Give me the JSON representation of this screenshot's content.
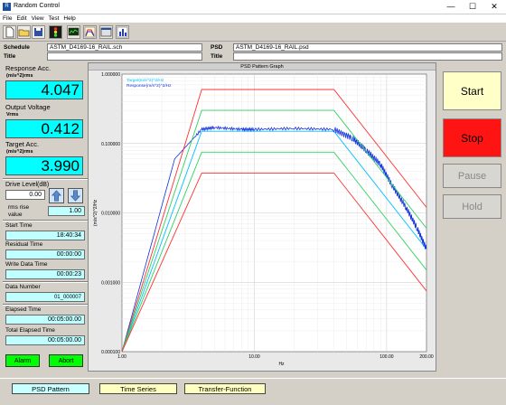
{
  "window": {
    "title": "Random Control",
    "minimize": "—",
    "maximize": "☐",
    "close": "✕"
  },
  "menu": [
    "File",
    "Edit",
    "View",
    "Test",
    "Help"
  ],
  "toolbar_icons": [
    "new-file-icon",
    "open-folder-icon",
    "save-icon",
    "traffic-light-icon",
    "monitor-icon",
    "psd-chart-icon",
    "window-icon",
    "bar-chart-icon"
  ],
  "header": {
    "schedule_label": "Schedule",
    "schedule_value": "ASTM_D4169-16_RAIL.sch",
    "title_label": "Title",
    "title_value": "",
    "psd_label": "PSD",
    "psd_value": "ASTM_D4169-16_RAIL.psd",
    "psd_title_label": "Title",
    "psd_title_value": ""
  },
  "left": {
    "response_label": "Response Acc.",
    "response_unit": "(m/s^2)rms",
    "response_value": "4.047",
    "output_label": "Output Voltage",
    "output_unit": "Vrms",
    "output_value": "0.412",
    "target_label": "Target Acc.",
    "target_unit": "(m/s^2)rms",
    "target_value": "3.990",
    "drive_label": "Drive Level(dB)",
    "drive_value": "0.00",
    "rms_rise_label_1": "rms rise",
    "rms_rise_label_2": "value",
    "rms_rise_value": "1.00",
    "start_time_label": "Start Time",
    "start_time_value": "18:40:34",
    "residual_label": "Residual Time",
    "residual_value": "00:00:00",
    "write_data_label": "Write Data Time",
    "write_data_value": "00:00:23",
    "data_number_label": "Data Number",
    "data_number_value": "01_000007",
    "elapsed_label": "Elapsed Time",
    "elapsed_value": "00:05:00.00",
    "total_elapsed_label": "Total Elapsed Time",
    "total_elapsed_value": "00:05:00.00",
    "alarm_label": "Alarm",
    "abort_label": "Abort"
  },
  "right": {
    "start_label": "Start",
    "stop_label": "Stop",
    "pause_label": "Pause",
    "hold_label": "Hold",
    "start_color": "#ffffc8",
    "stop_color": "#ff1414"
  },
  "bottom": {
    "psd_pattern": "PSD Pattern",
    "time_series": "Time Series",
    "transfer_function": "Transfer-Function"
  },
  "chart_data": {
    "type": "line",
    "title": "PSD Pattern Graph",
    "xlabel": "Hz",
    "ylabel": "(m/s^2)^2/Hz",
    "xscale": "log",
    "yscale": "log",
    "xlim": [
      1.0,
      200.0
    ],
    "ylim": [
      0.0001,
      1.0
    ],
    "x_ticks": [
      "1.00",
      "10.00",
      "100.00",
      "200.00"
    ],
    "y_ticks": [
      "1.000000",
      "0.100000",
      "0.010000",
      "0.001000",
      "0.000100"
    ],
    "grid": true,
    "legend_placement": "top-left",
    "series": [
      {
        "name": "Target(m/s^2)^2/Hz",
        "color": "#00c0ff",
        "x": [
          1,
          4,
          40,
          200
        ],
        "y": [
          0.0001,
          0.15,
          0.15,
          0.003
        ]
      },
      {
        "name": "Response(m/s^2)^2/Hz",
        "color": "#1030e0",
        "x": [
          1,
          2.5,
          4,
          5,
          8,
          10,
          20,
          40,
          55,
          70,
          90,
          110,
          140,
          170,
          200
        ],
        "y": [
          0.0001,
          0.06,
          0.16,
          0.17,
          0.16,
          0.16,
          0.165,
          0.16,
          0.12,
          0.08,
          0.05,
          0.025,
          0.012,
          0.006,
          0.003
        ]
      },
      {
        "color": "#ff3030",
        "x": [
          1,
          4,
          40,
          200
        ],
        "y": [
          0.0001,
          0.6,
          0.6,
          0.012
        ]
      },
      {
        "color": "#30d060",
        "x": [
          1,
          4,
          40,
          200
        ],
        "y": [
          0.0001,
          0.3,
          0.3,
          0.006
        ]
      },
      {
        "color": "#30d060",
        "x": [
          1,
          4,
          40,
          200
        ],
        "y": [
          0.0001,
          0.075,
          0.075,
          0.0015
        ]
      },
      {
        "color": "#ff3030",
        "x": [
          1,
          4,
          40,
          200
        ],
        "y": [
          0.0001,
          0.0375,
          0.0375,
          0.00075
        ]
      }
    ]
  }
}
